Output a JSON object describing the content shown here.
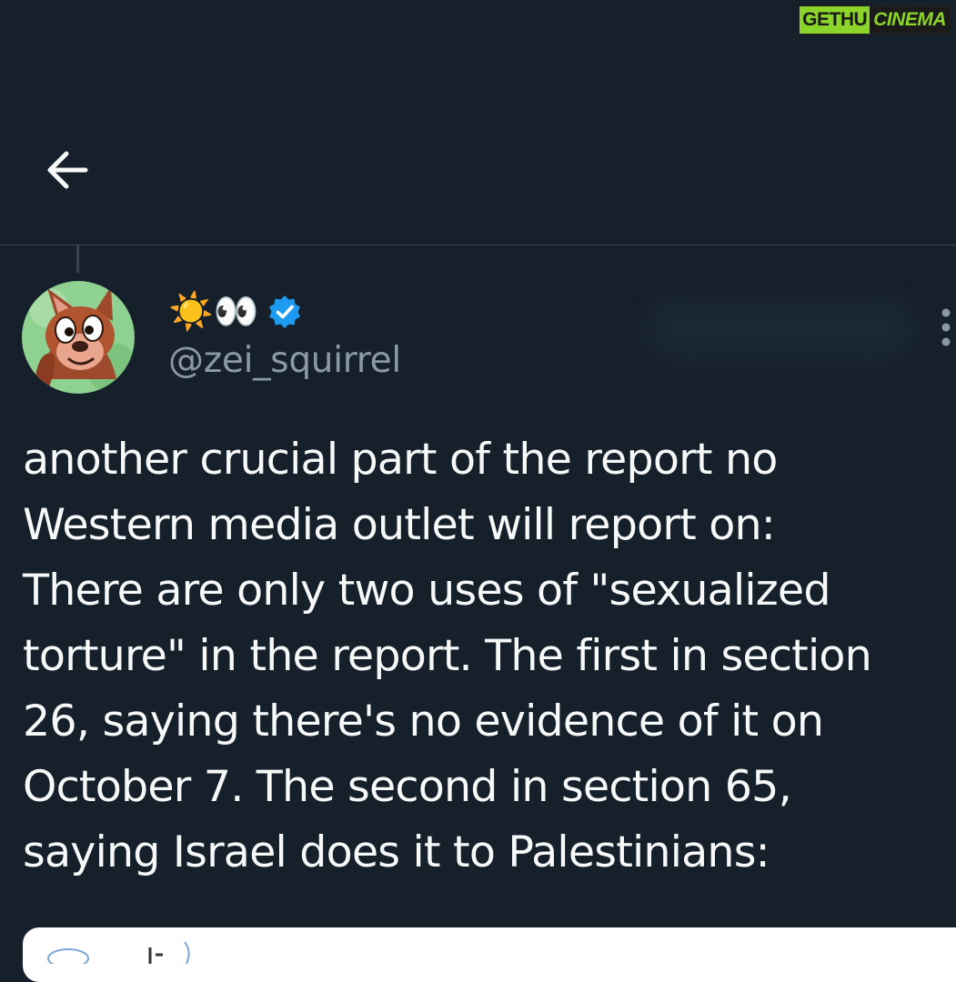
{
  "watermark": {
    "left_text": "GETHU",
    "right_text": "CINEMA"
  },
  "nav": {
    "back_icon": "arrow-left-icon"
  },
  "tweet": {
    "display_name_emoji": "☀️👀",
    "verified_icon": "verified-badge-icon",
    "handle": "@zei_squirrel",
    "avatar_icon": "squirrel-cartoon-avatar",
    "more_icon": "vertical-ellipsis-icon",
    "text": "another crucial part of the report no\nWestern media outlet will report on:\nThere are only two uses of \"sexualized\ntorture\" in the report. The first in section\n26, saying there's no evidence of it on\nOctober 7. The second in section 65,\nsaying Israel does it to Palestinians:"
  },
  "colors": {
    "background": "#15202b",
    "text_primary": "#f7f9f9",
    "text_secondary": "#8b98a5",
    "verified_blue": "#1d9bf0",
    "divider": "#38444d",
    "watermark_green": "#8bd42a"
  }
}
